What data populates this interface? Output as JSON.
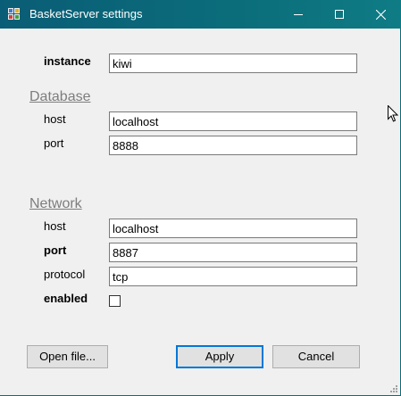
{
  "window": {
    "title": "BasketServer settings",
    "controls": {
      "minimize": "minimize-icon",
      "maximize": "maximize-icon",
      "close": "close-icon"
    }
  },
  "instance": {
    "label": "instance",
    "value": "kiwi"
  },
  "database": {
    "group_label": "Database",
    "host_label": "host",
    "host_value": "localhost",
    "port_label": "port",
    "port_value": "8888"
  },
  "network": {
    "group_label": "Network",
    "host_label": "host",
    "host_value": "localhost",
    "port_label": "port",
    "port_value": "8887",
    "protocol_label": "protocol",
    "protocol_value": "tcp",
    "enabled_label": "enabled",
    "enabled_checked": false
  },
  "buttons": {
    "open_file": "Open file...",
    "apply": "Apply",
    "cancel": "Cancel"
  },
  "colors": {
    "titlebar": "#0b6d7a",
    "default_button_border": "#0078d7",
    "group_label": "#7d7d7d"
  }
}
